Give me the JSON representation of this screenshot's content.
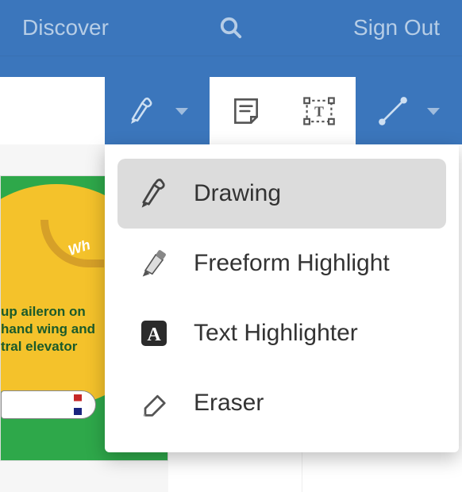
{
  "header": {
    "discover": "Discover",
    "signout": "Sign Out"
  },
  "toolbar": {
    "tools": {
      "pen": "pen-tool",
      "note": "note-tool",
      "textbox": "textbox-tool",
      "line": "line-tool"
    }
  },
  "dropdown": {
    "items": [
      {
        "label": "Drawing",
        "icon": "pen-icon",
        "selected": true
      },
      {
        "label": "Freeform Highlight",
        "icon": "highlighter-icon",
        "selected": false
      },
      {
        "label": "Text Highlighter",
        "icon": "text-a-icon",
        "selected": false
      },
      {
        "label": "Eraser",
        "icon": "eraser-icon",
        "selected": false
      }
    ]
  },
  "document": {
    "whoosh": "Wh",
    "caption_line1": "up aileron on",
    "caption_line2": "hand wing and",
    "caption_line3": "tral elevator"
  },
  "colors": {
    "primary": "#3b76bc",
    "muted": "#b6cde6",
    "selected_bg": "#dcdcdc"
  }
}
